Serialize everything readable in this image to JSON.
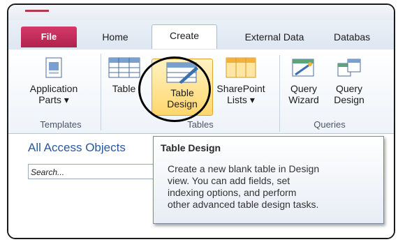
{
  "tabs": [
    "File",
    "Home",
    "Create",
    "External Data",
    "Databas"
  ],
  "ribbon": {
    "application_parts": [
      "Application",
      "Parts ▾"
    ],
    "table": "Table",
    "table_design": [
      "Table",
      "Design"
    ],
    "sharepoint_lists": [
      "SharePoint",
      "Lists ▾"
    ],
    "query_wizard": [
      "Query",
      "Wizard"
    ],
    "query_design": [
      "Query",
      "Design"
    ],
    "groups": {
      "templates": "Templates",
      "tables": "Tables",
      "queries": "Queries"
    }
  },
  "nav": {
    "header": "All Access Objects",
    "search_placeholder": "Search..."
  },
  "tooltip": {
    "title": "Table Design",
    "lines": [
      "Create a new blank table in Design",
      "view. You can add fields, set",
      "indexing options, and perform",
      "other advanced table design tasks."
    ]
  },
  "colors": {
    "file_tab": "#c62a5a",
    "highlight": "#ffd66e",
    "accent": "#2b579a"
  }
}
